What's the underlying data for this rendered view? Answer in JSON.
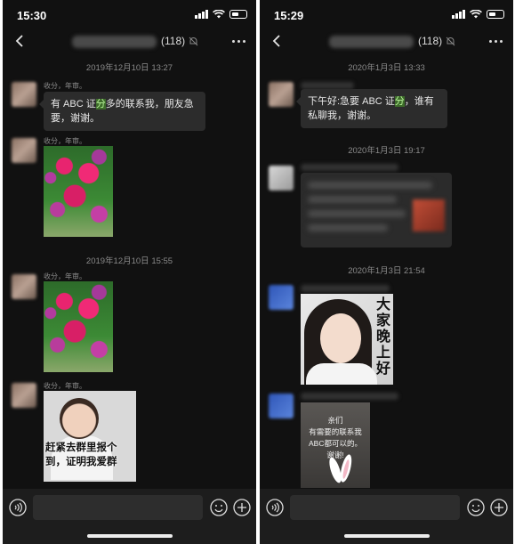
{
  "left_screen": {
    "status": {
      "time": "15:30"
    },
    "header": {
      "member_count": "(118)"
    },
    "messages": [
      {
        "timestamp": "2019年12月10日 13:27"
      },
      {
        "sender": "收分，年审。",
        "text_before": "有 ABC 证",
        "text_highlight": "分",
        "text_after": "多的联系我，朋友急要，谢谢。"
      },
      {
        "sender": "收分，年审。"
      },
      {
        "timestamp": "2019年12月10日 15:55"
      },
      {
        "sender": "收分，年审。"
      },
      {
        "sender": "收分，年审。",
        "image_caption": "赶紧去群里报个到，证明我爱群"
      }
    ]
  },
  "right_screen": {
    "status": {
      "time": "15:29"
    },
    "header": {
      "member_count": "(118)"
    },
    "messages": [
      {
        "timestamp": "2020年1月3日 13:33"
      },
      {
        "text_before": "下午好:急要 ABC 证",
        "text_highlight": "分",
        "text_after": "，谁有私聊我，谢谢。"
      },
      {
        "timestamp": "2020年1月3日 19:17"
      },
      {
        "timestamp": "2020年1月3日 21:54"
      },
      {
        "image_caption": "大家晚上好"
      },
      {
        "image_caption_lines": [
          "亲们",
          "有需要的联系我",
          "ABC都可以的。",
          "谢谢!"
        ]
      }
    ]
  },
  "icons": [
    "back-icon",
    "mute-icon",
    "more-icon",
    "voice-icon",
    "emoji-icon",
    "plus-icon",
    "signal-icon",
    "wifi-icon",
    "battery-icon"
  ],
  "colors": {
    "background": "#111111",
    "bubble": "#2c2c2c",
    "highlight": "#3d6b2a",
    "timestamp": "#8a8a8a"
  }
}
